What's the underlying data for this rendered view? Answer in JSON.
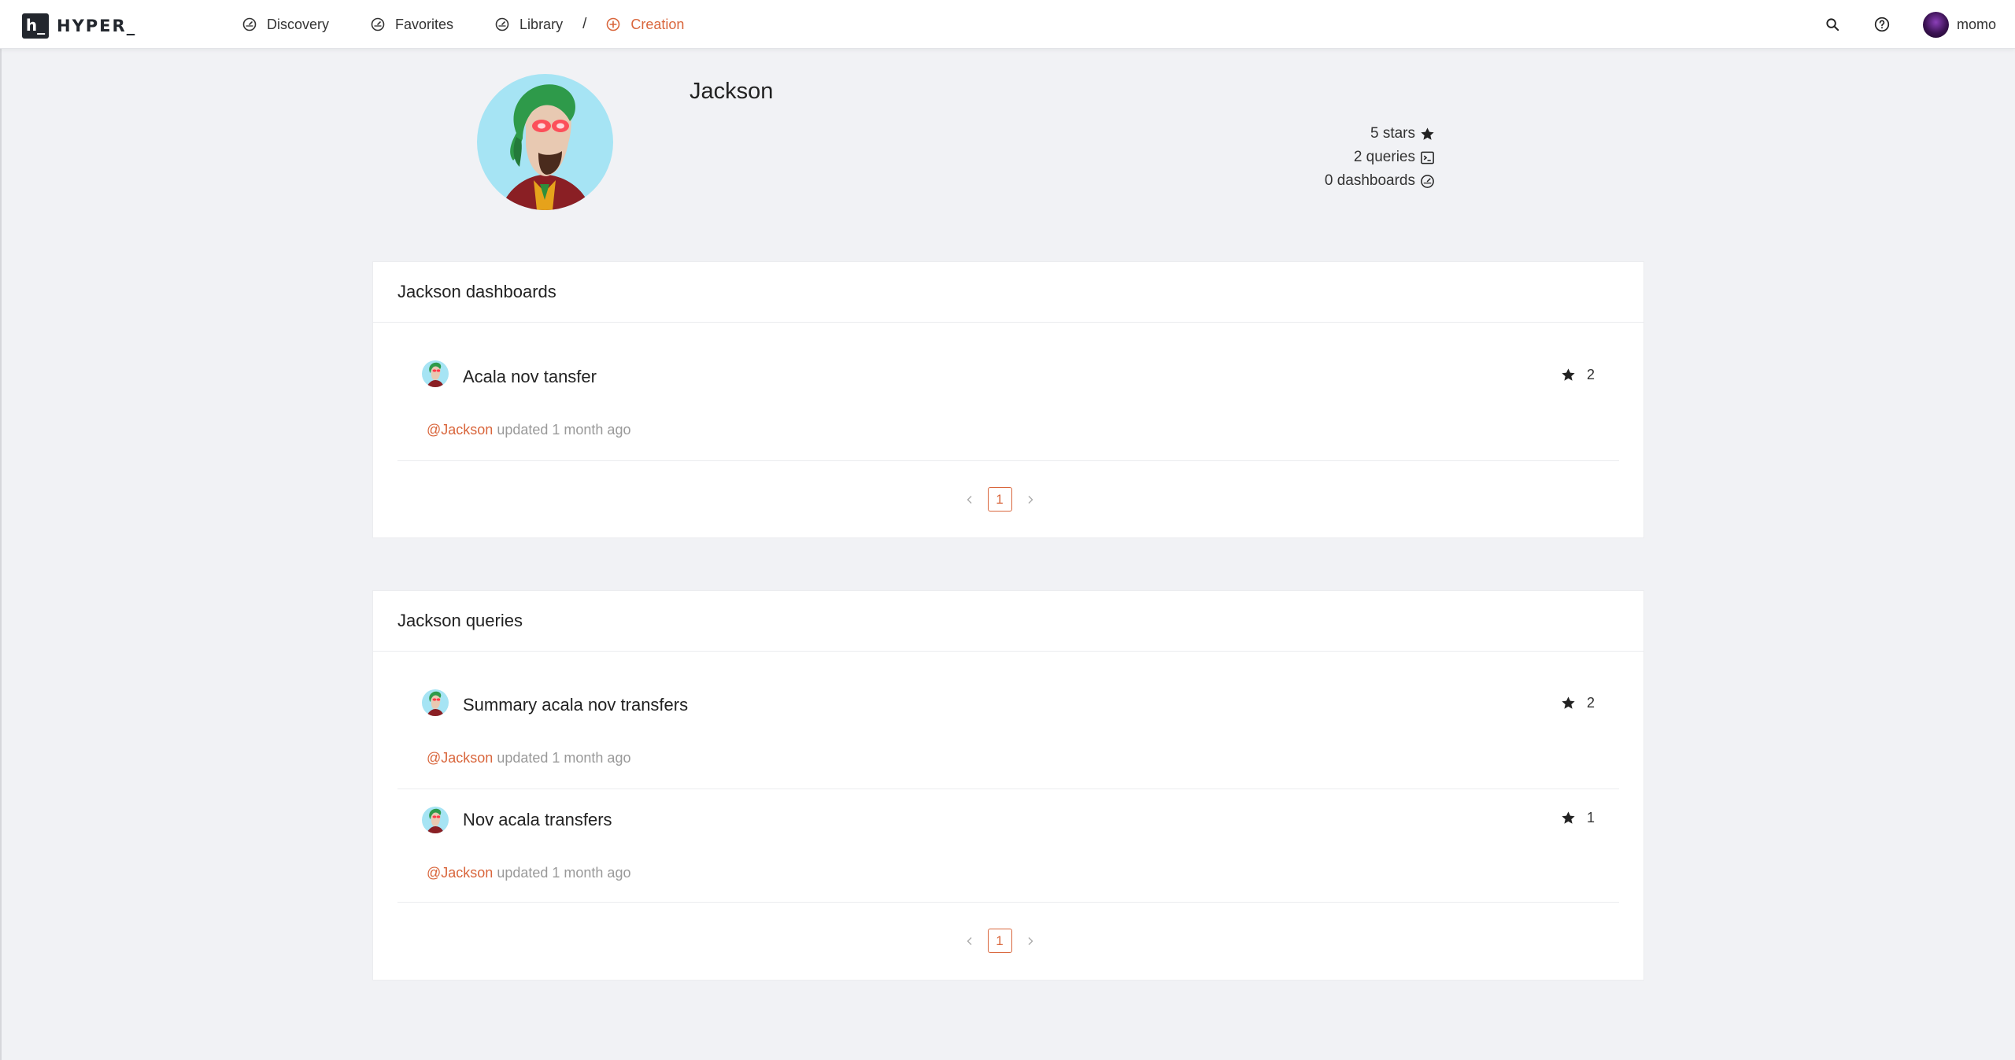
{
  "app": {
    "logo_letter": "h_",
    "logo_text": "HYPER_"
  },
  "nav": {
    "discovery": "Discovery",
    "favorites": "Favorites",
    "library": "Library",
    "separator": "/",
    "creation": "Creation"
  },
  "user": {
    "name": "momo"
  },
  "profile": {
    "name": "Jackson",
    "stars": "5 stars",
    "queries": "2 queries",
    "dashboards": "0 dashboards"
  },
  "dashboards": {
    "header": "Jackson dashboards",
    "items": [
      {
        "title": "Acala nov tansfer",
        "stars": "2",
        "author": "@Jackson",
        "updated": "updated 1 month ago"
      }
    ],
    "page": "1"
  },
  "queries": {
    "header": "Jackson queries",
    "items": [
      {
        "title": "Summary acala nov transfers",
        "stars": "2",
        "author": "@Jackson",
        "updated": "updated 1 month ago"
      },
      {
        "title": "Nov acala transfers",
        "stars": "1",
        "author": "@Jackson",
        "updated": "updated 1 month ago"
      }
    ],
    "page": "1"
  },
  "colors": {
    "accent": "#d9663c",
    "background": "#f1f2f5",
    "avatar_bg": "#a6e4f4"
  }
}
